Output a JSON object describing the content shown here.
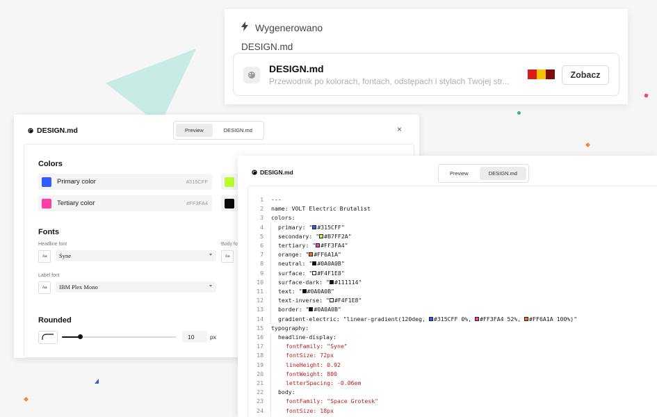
{
  "top_card": {
    "status_label": "Wygenerowano",
    "file_name": "DESIGN.md",
    "item": {
      "title": "DESIGN.md",
      "description": "Przewodnik po kolorach, fontach, odstępach i stylach Twojej str...",
      "preview_swatch_colors": [
        "#d91e18",
        "#f5c400",
        "#7a0d0d"
      ],
      "button_label": "Zobacz"
    }
  },
  "left_panel": {
    "title": "DESIGN.md",
    "tabs": [
      "Preview",
      "DESIGN.md"
    ],
    "active_tab": "Preview",
    "close_label": "×",
    "colors_heading": "Colors",
    "colors": [
      {
        "name": "Primary color",
        "hex": "#315CFF",
        "chip": "#315CFF"
      },
      {
        "name": "Tertiary color",
        "hex": "#FF3FA4",
        "chip": "#FF3FA4"
      }
    ],
    "extra_chips": [
      "#B7FF2A",
      "#0A0A0B"
    ],
    "fonts_heading": "Fonts",
    "headline_font_label": "Headline font",
    "headline_font_value": "Syne",
    "body_font_label": "Body fo",
    "label_font_label": "Label font",
    "label_font_value": "IBM Plex Mono",
    "font_icon_text": "Aa",
    "rounded_heading": "Rounded",
    "rounded_value": "10",
    "rounded_unit": "px",
    "rounded_slider_fraction": 0.16
  },
  "right_panel": {
    "title": "DESIGN.md",
    "tabs": [
      "Preview",
      "DESIGN.md"
    ],
    "active_tab": "DESIGN.md",
    "code_lines": [
      {
        "n": "1",
        "text": "---"
      },
      {
        "n": "2",
        "text": "name: VOLT Electric Brutalist"
      },
      {
        "n": "3",
        "text": "colors:"
      },
      {
        "n": "4",
        "key": "primary: ",
        "swatch": "#315CFF",
        "val": "#315CFF"
      },
      {
        "n": "5",
        "key": "secondary: ",
        "swatch": "#B7FF2A",
        "val": "#B7FF2A"
      },
      {
        "n": "6",
        "key": "tertiary: ",
        "swatch": "#FF3FA4",
        "val": "#FF3FA4"
      },
      {
        "n": "7",
        "key": "orange: ",
        "swatch": "#FF6A1A",
        "val": "#FF6A1A"
      },
      {
        "n": "8",
        "key": "neutral: ",
        "swatch": "#0A0A0B",
        "val": "#0A0A0B"
      },
      {
        "n": "9",
        "key": "surface: ",
        "swatch": "#F4F1E8",
        "val": "#F4F1E8"
      },
      {
        "n": "10",
        "key": "surface-dark: ",
        "swatch": "#111114",
        "val": "#111114"
      },
      {
        "n": "11",
        "key": "text: ",
        "swatch": "#0A0A0B",
        "val": "#0A0A0B"
      },
      {
        "n": "12",
        "key": "text-inverse: ",
        "swatch": "#F4F1E8",
        "val": "#F4F1E8"
      },
      {
        "n": "13",
        "key": "border: ",
        "swatch": "#0A0A0B",
        "val": "#0A0A0B"
      },
      {
        "n": "14",
        "gradient": true,
        "key": "gradient-electric: ",
        "prefix": "\"linear-gradient(120deg, ",
        "stops": [
          {
            "swatch": "#315CFF",
            "text": "#315CFF 0%, "
          },
          {
            "swatch": "#FF3FA4",
            "text": "#FF3FA4 52%, "
          },
          {
            "swatch": "#FF6A1A",
            "text": "#FF6A1A 100%)\""
          }
        ]
      },
      {
        "n": "15",
        "text": "typography:"
      },
      {
        "n": "16",
        "level": 1,
        "text": "headline-display:"
      },
      {
        "n": "17",
        "level": 2,
        "red": "fontFamily: \"Syne\""
      },
      {
        "n": "18",
        "level": 2,
        "red": "fontSize: 72px"
      },
      {
        "n": "19",
        "level": 2,
        "red": "lineHeight: 0.92"
      },
      {
        "n": "20",
        "level": 2,
        "red": "fontWeight: 800"
      },
      {
        "n": "21",
        "level": 2,
        "red": "letterSpacing: -0.06em"
      },
      {
        "n": "22",
        "level": 1,
        "text": "body:"
      },
      {
        "n": "23",
        "level": 2,
        "red": "fontFamily: \"Space Grotesk\""
      },
      {
        "n": "24",
        "level": 2,
        "red": "fontSize: 18px"
      }
    ]
  }
}
